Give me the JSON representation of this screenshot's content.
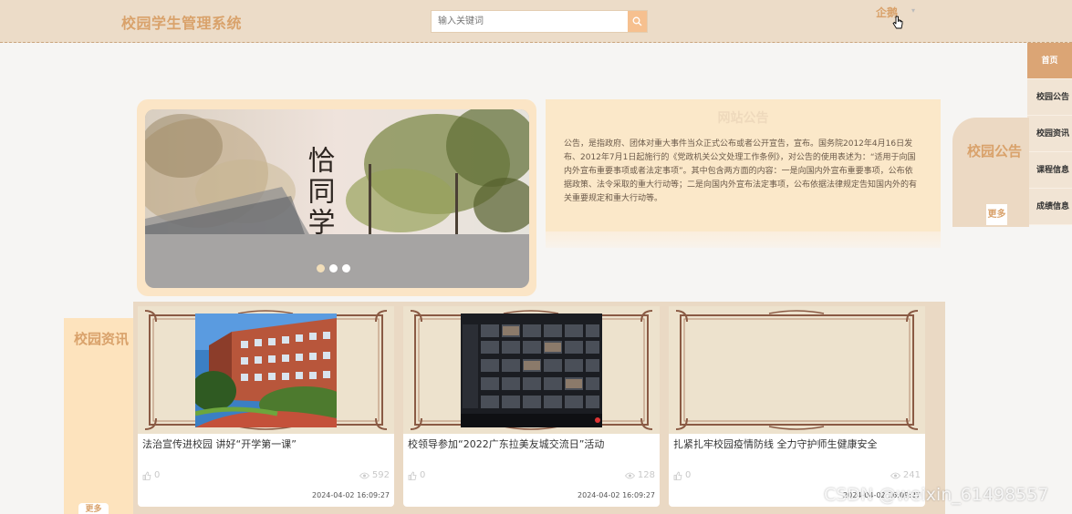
{
  "header": {
    "logo": "校园学生管理系统",
    "search_placeholder": "输入关键词",
    "username": "企鹅",
    "caret": "▾"
  },
  "right_nav": [
    {
      "label": "首页",
      "active": true
    },
    {
      "label": "校园公告"
    },
    {
      "label": "校园资讯"
    },
    {
      "label": "课程信息"
    },
    {
      "label": "成绩信息"
    }
  ],
  "notice": {
    "title": "网站公告",
    "text": "公告，是指政府、团体对重大事件当众正式公布或者公开宣告，宣布。国务院2012年4月16日发布、2012年7月1日起施行的《党政机关公文处理工作条例》，对公告的使用表述为：“适用于向国内外宣布重要事项或者法定事项”。其中包含两方面的内容：一是向国内外宣布重要事项，公布依据政策、法令采取的重大行动等；二是向国内外宣布法定事项，公布依据法律规定告知国内外的有关重要规定和重大行动等。",
    "side_title": "校园公告",
    "more": "更多"
  },
  "banner": {
    "calligraphy": "恰同学少",
    "slide_count": 3,
    "active_slide": 1
  },
  "news": {
    "side_title": "校园资讯",
    "more": "更多",
    "items": [
      {
        "title": "法治宣传进校园 讲好“开学第一课”",
        "likes": "0",
        "views": "592",
        "date": "2024-04-02 16:09:27"
      },
      {
        "title": "校领导参加“2022广东拉美友城交流日”活动",
        "likes": "0",
        "views": "128",
        "date": "2024-04-02 16:09:27"
      },
      {
        "title": "扎紧扎牢校园疫情防线 全力守护师生健康安全",
        "likes": "0",
        "views": "241",
        "date": "2024-04-02 16:09:27"
      }
    ]
  },
  "watermark": "CSDN @weixin_61498557",
  "colors": {
    "accent": "#d9a26b",
    "header_bg": "#ecdcc8",
    "panel_bg": "#fbe8c9",
    "nav_active": "#dba575"
  }
}
